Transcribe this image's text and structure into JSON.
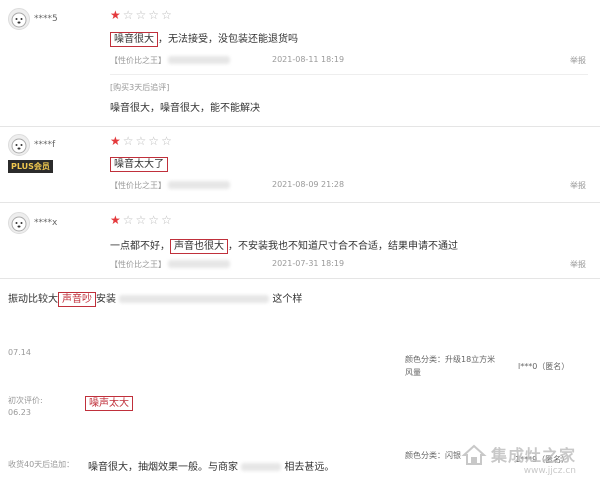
{
  "reviews": [
    {
      "username": "****5",
      "rating": 1,
      "keyword": "噪音很大",
      "content_rest": "，无法接受，没包装还能退货吗",
      "spec": "【性价比之王】",
      "date": "2021-08-11 18:19",
      "report": "举报",
      "followup_label": "[购买3天后追评]",
      "followup_text": "噪音很大，噪音很大，能不能解决"
    },
    {
      "username": "****f",
      "badge": "PLUS会员",
      "rating": 1,
      "keyword": "噪音太大了",
      "spec": "【性价比之王】",
      "date": "2021-08-09 21:28",
      "report": "举报"
    },
    {
      "username": "****x",
      "rating": 1,
      "content_pre": "一点都不好，",
      "keyword": "声音也很大",
      "content_rest": "，不安装我也不知道尺寸合不合适，结果申请不通过",
      "spec": "【性价比之王】",
      "date": "2021-07-31 18:19",
      "report": "举报"
    }
  ],
  "lower": {
    "line1_pre": "振动比较大",
    "line1_keyword": "声音吵",
    "line1_mid": "安装",
    "line1_end": "这个样",
    "date1": "07.14",
    "color_label": "颜色分类：升级18立方米",
    "color_label2": "风量",
    "user1": "l***0（匿名）",
    "first_review_label": "初次评价:",
    "first_review_date": "06.23",
    "first_review_keyword": "噪声太大",
    "followup_label": "收货40天后追加：",
    "followup_text": "噪音很大，抽烟效果一般。与商家",
    "followup_end": "相去甚远。",
    "color_label3": "颜色分类：",
    "color_val3": "闪银",
    "user2": "1***9（匿名）"
  },
  "watermark": {
    "main": "集成灶之家",
    "url": "www.jjcz.cn"
  }
}
